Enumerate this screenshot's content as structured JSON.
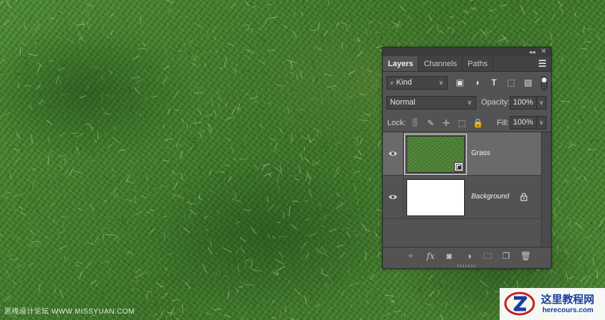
{
  "canvas": {
    "description_color": "#3f7a2c"
  },
  "panel": {
    "tabs": [
      {
        "label": "Layers",
        "active": true
      },
      {
        "label": "Channels",
        "active": false
      },
      {
        "label": "Paths",
        "active": false
      }
    ],
    "filter": {
      "label": "Kind",
      "icons": [
        "image-filter-icon",
        "adjustment-filter-icon",
        "type-filter-icon",
        "shape-filter-icon",
        "smartobject-filter-icon"
      ]
    },
    "blend_mode": "Normal",
    "opacity": {
      "label": "Opacity:",
      "value": "100%"
    },
    "lock": {
      "label": "Lock:",
      "icons": [
        "lock-transparent-icon",
        "lock-paint-icon",
        "lock-position-icon",
        "lock-artboard-icon",
        "lock-all-icon"
      ]
    },
    "fill": {
      "label": "Fill:",
      "value": "100%"
    },
    "layers": [
      {
        "name": "Grass",
        "visible": true,
        "selected": true,
        "smart_object": true,
        "locked": false
      },
      {
        "name": "Background",
        "visible": true,
        "selected": false,
        "smart_object": false,
        "locked": true
      }
    ],
    "bottom_icons": [
      "link-icon",
      "fx-icon",
      "mask-icon",
      "adjustment-layer-icon",
      "group-folder-icon",
      "new-layer-icon",
      "trash-icon"
    ]
  },
  "watermark": {
    "left_text": "思缘设计论坛  WWW.MISSYUAN.COM",
    "right_cn": "这里教程网",
    "right_url": "herecours.com"
  },
  "colors": {
    "panel_bg": "#535353",
    "selected_row": "#6a6a6a",
    "tab_bar": "#424242"
  }
}
